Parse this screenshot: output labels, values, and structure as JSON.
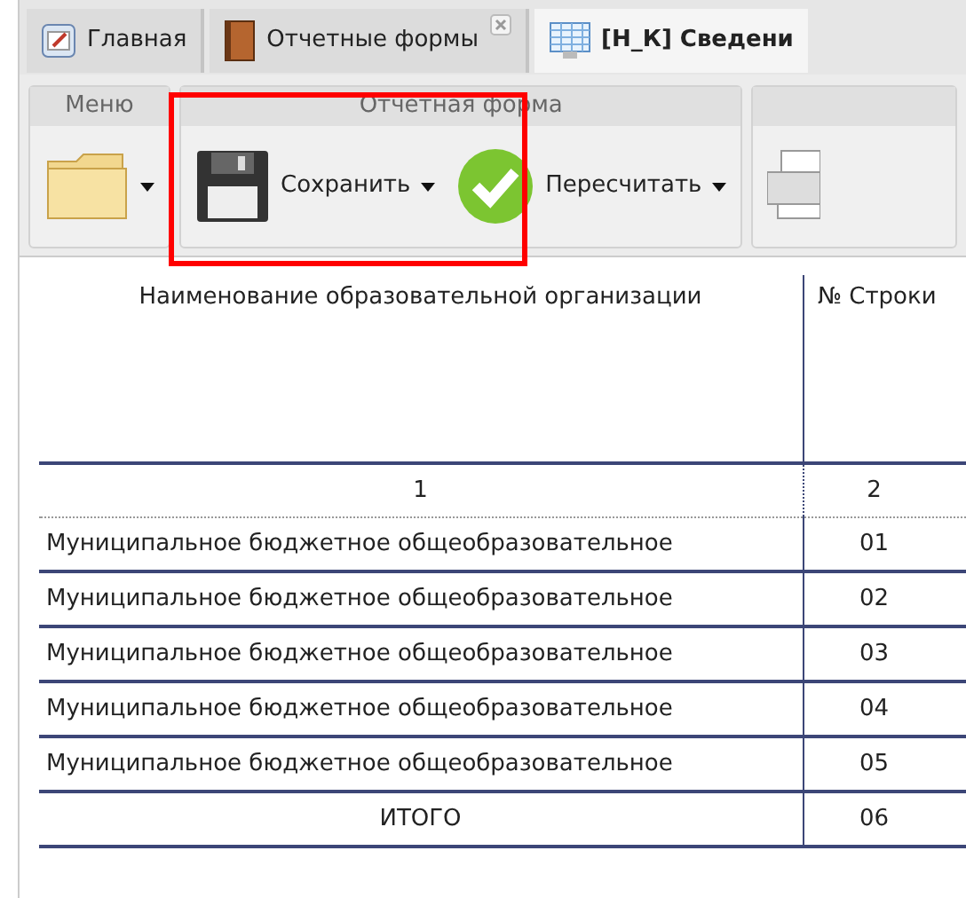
{
  "tabs": [
    {
      "label": "Главная",
      "kind": "home",
      "selected": false,
      "closable": false
    },
    {
      "label": "Отчетные формы",
      "kind": "book",
      "selected": false,
      "closable": true
    },
    {
      "label": "[Н_К] Сведени",
      "kind": "table",
      "selected": true,
      "closable": false
    }
  ],
  "toolbar": {
    "groups": [
      {
        "title": "Меню",
        "buttons": [
          {
            "kind": "folder",
            "dropdown": true
          }
        ]
      },
      {
        "title": "Отчетная форма",
        "highlighted": true,
        "buttons": [
          {
            "kind": "save",
            "label": "Сохранить",
            "dropdown": true
          },
          {
            "kind": "check",
            "label": "Пересчитать",
            "dropdown": true
          }
        ]
      },
      {
        "buttons": [
          {
            "kind": "printer",
            "dropdown": false
          }
        ]
      }
    ]
  },
  "table": {
    "columns": [
      "Наименование образовательной организации",
      "№ Строки"
    ],
    "column_numbers": [
      "1",
      "2"
    ],
    "rows": [
      {
        "name": "Муниципальное бюджетное общеобразовательное",
        "line": "01",
        "total": false
      },
      {
        "name": "Муниципальное бюджетное общеобразовательное",
        "line": "02",
        "total": false
      },
      {
        "name": "Муниципальное бюджетное общеобразовательное",
        "line": "03",
        "total": false
      },
      {
        "name": "Муниципальное бюджетное общеобразовательное",
        "line": "04",
        "total": false
      },
      {
        "name": "Муниципальное бюджетное общеобразовательное",
        "line": "05",
        "total": false
      },
      {
        "name": "ИТОГО",
        "line": "06",
        "total": true
      }
    ]
  }
}
